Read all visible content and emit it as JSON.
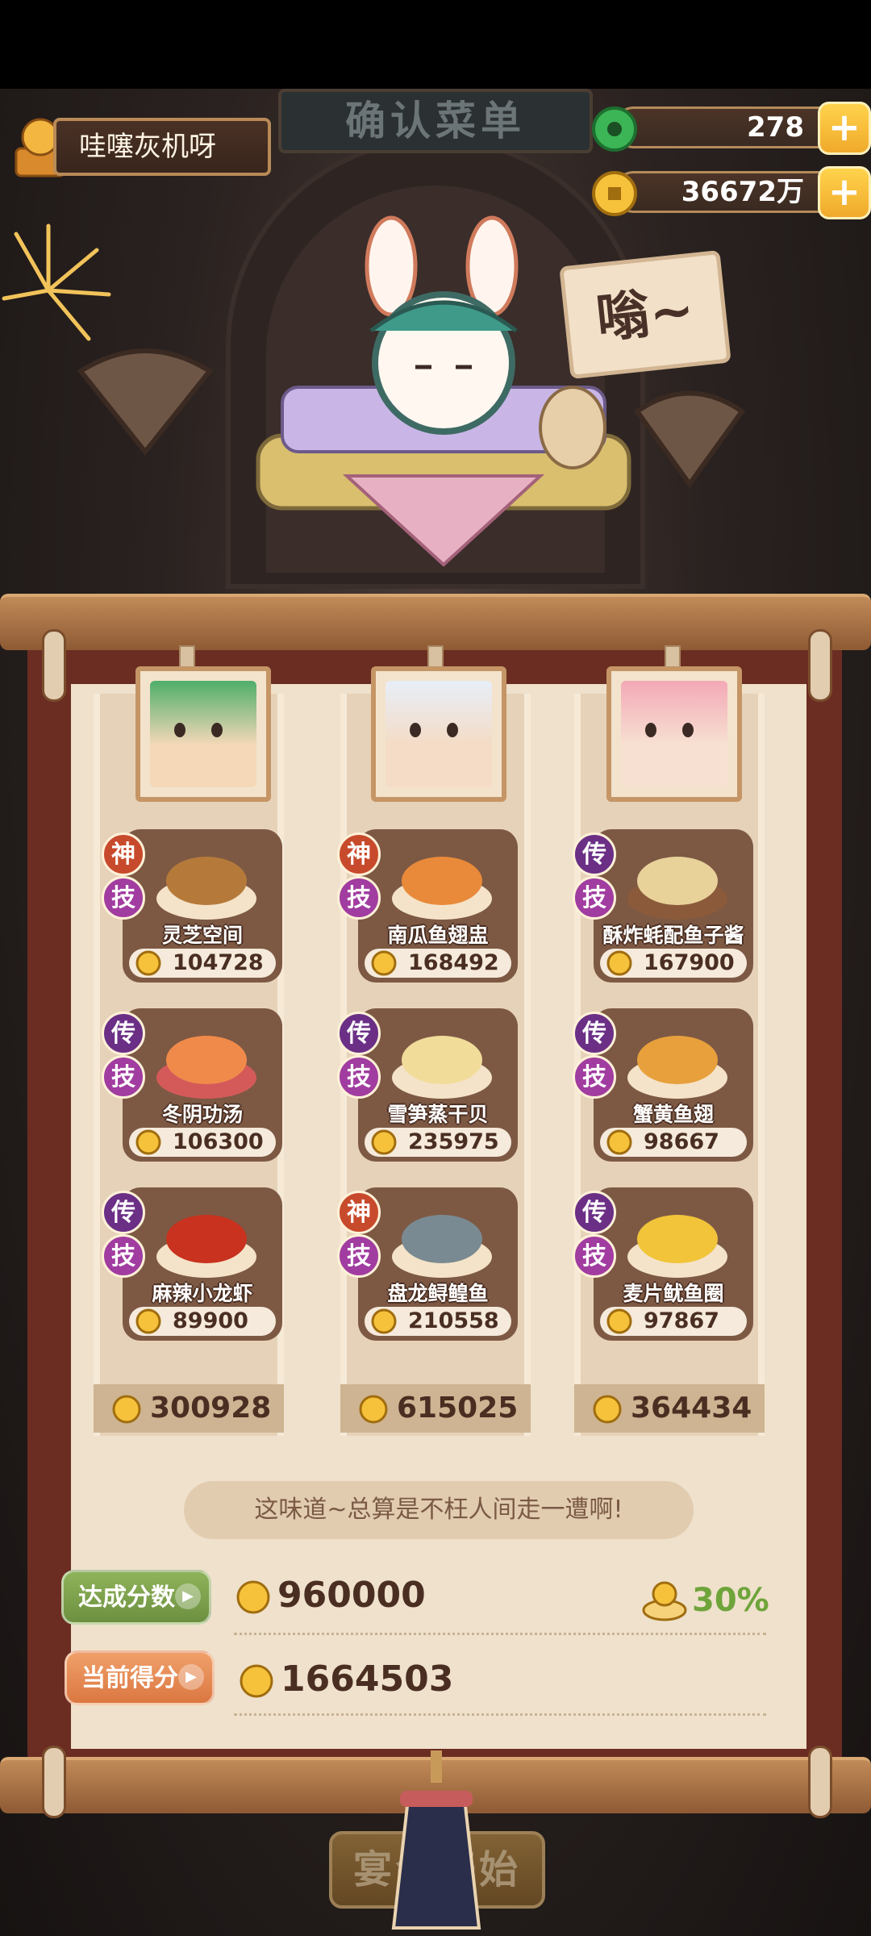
{
  "header": {
    "sign_text": "确认菜单",
    "player_name": "哇噻灰机呀"
  },
  "currency": {
    "jade": "278",
    "gold": "36672万"
  },
  "speech": "嗡~",
  "columns": [
    {
      "total": "300928",
      "dishes": [
        {
          "badge": "神",
          "skill": "技",
          "name": "灵芝空间",
          "score": "104728"
        },
        {
          "badge": "传",
          "skill": "技",
          "name": "冬阴功汤",
          "score": "106300"
        },
        {
          "badge": "传",
          "skill": "技",
          "name": "麻辣小龙虾",
          "score": "89900"
        }
      ]
    },
    {
      "total": "615025",
      "dishes": [
        {
          "badge": "神",
          "skill": "技",
          "name": "南瓜鱼翅盅",
          "score": "168492"
        },
        {
          "badge": "传",
          "skill": "技",
          "name": "雪笋蒸干贝",
          "score": "235975"
        },
        {
          "badge": "神",
          "skill": "技",
          "name": "盘龙鲟鳇鱼",
          "score": "210558"
        }
      ]
    },
    {
      "total": "364434",
      "dishes": [
        {
          "badge": "传",
          "skill": "技",
          "name": "酥炸蚝配鱼子酱",
          "score": "167900"
        },
        {
          "badge": "传",
          "skill": "技",
          "name": "蟹黄鱼翅",
          "score": "98667"
        },
        {
          "badge": "传",
          "skill": "技",
          "name": "麦片鱿鱼圈",
          "score": "97867"
        }
      ]
    }
  ],
  "quote": "这味道~总算是不枉人间走一遭啊!",
  "target": {
    "label": "达成分数",
    "value": "960000",
    "bonus": "30%"
  },
  "current": {
    "label": "当前得分",
    "value": "1664503"
  },
  "start_button": "宴会开始",
  "colors": {
    "panel": "#6b2d22",
    "parchment": "#efe1cc",
    "gold": "#f0a92b",
    "bonus_green": "#6fa43b"
  }
}
